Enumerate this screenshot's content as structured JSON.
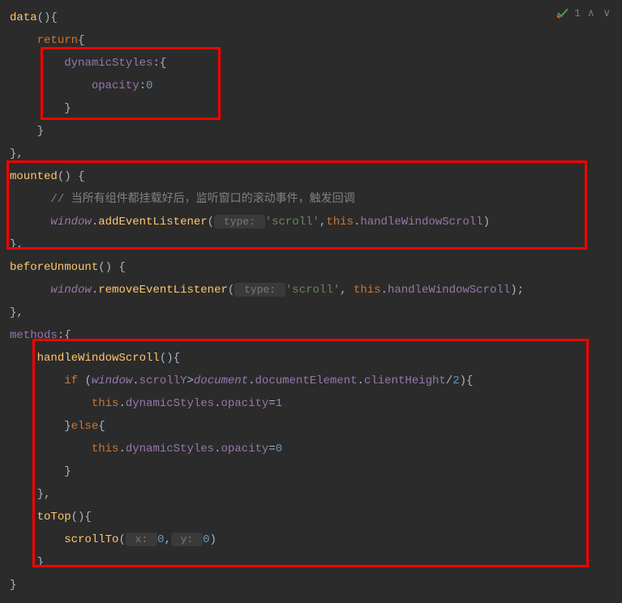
{
  "topbar": {
    "count": "1"
  },
  "code": {
    "l1": {
      "fn": "data",
      "p1": "(){"
    },
    "l2": {
      "kw": "return",
      "p1": "{"
    },
    "l3": {
      "prop": "dynamicStyles",
      "p1": ":{"
    },
    "l4": {
      "prop": "opacity",
      "p1": ":",
      "num": "0"
    },
    "l5": {
      "p1": "}"
    },
    "l6": {
      "p1": "}"
    },
    "l7": {
      "p1": "},"
    },
    "l8": {
      "fn": "mounted",
      "p1": "() {"
    },
    "l9": {
      "comment": "// 当所有组件都挂载好后，监听窗口的滚动事件，触发回调"
    },
    "l10": {
      "obj": "window",
      "p1": ".",
      "fn": "addEventListener",
      "p2": "(",
      "hint": " type: ",
      "str": "'scroll'",
      "p3": ",",
      "this": "this",
      "p4": ".",
      "prop": "handleWindowScroll",
      "p5": ")"
    },
    "l11": {
      "p1": "},"
    },
    "l12": {
      "fn": "beforeUnmount",
      "p1": "() {"
    },
    "l13": {
      "obj": "window",
      "p1": ".",
      "fn": "removeEventListener",
      "p2": "(",
      "hint": " type: ",
      "str": "'scroll'",
      "p3": ", ",
      "this": "this",
      "p4": ".",
      "prop": "handleWindowScroll",
      "p5": ");"
    },
    "l14": {
      "p1": "},"
    },
    "l15": {
      "prop": "methods",
      "p1": ":{"
    },
    "l16": {
      "fn": "handleWindowScroll",
      "p1": "(){"
    },
    "l17": {
      "kw": "if ",
      "p1": "(",
      "obj": "window",
      "p2": ".",
      "prop1": "scrollY",
      "p3": ">",
      "obj2": "document",
      "p4": ".",
      "prop2": "documentElement",
      "p5": ".",
      "prop3": "clientHeight",
      "p6": "/",
      "num": "2",
      "p7": "){"
    },
    "l18": {
      "this": "this",
      "p1": ".",
      "prop1": "dynamicStyles",
      "p2": ".",
      "prop2": "opacity",
      "p3": "=",
      "num": "1"
    },
    "l19": {
      "p1": "}",
      "kw": "else",
      "p2": "{"
    },
    "l20": {
      "this": "this",
      "p1": ".",
      "prop1": "dynamicStyles",
      "p2": ".",
      "prop2": "opacity",
      "p3": "=",
      "num": "0"
    },
    "l21": {
      "p1": "}"
    },
    "l22": {
      "p1": "},"
    },
    "l23": {
      "fn": "toTop",
      "p1": "(){"
    },
    "l24": {
      "fn": "scrollTo",
      "p1": "(",
      "hint1": " x: ",
      "num1": "0",
      "p2": ",",
      "hint2": " y: ",
      "num2": "0",
      "p3": ")"
    },
    "l25": {
      "p1": "}"
    },
    "l26": {
      "p1": "}"
    }
  }
}
